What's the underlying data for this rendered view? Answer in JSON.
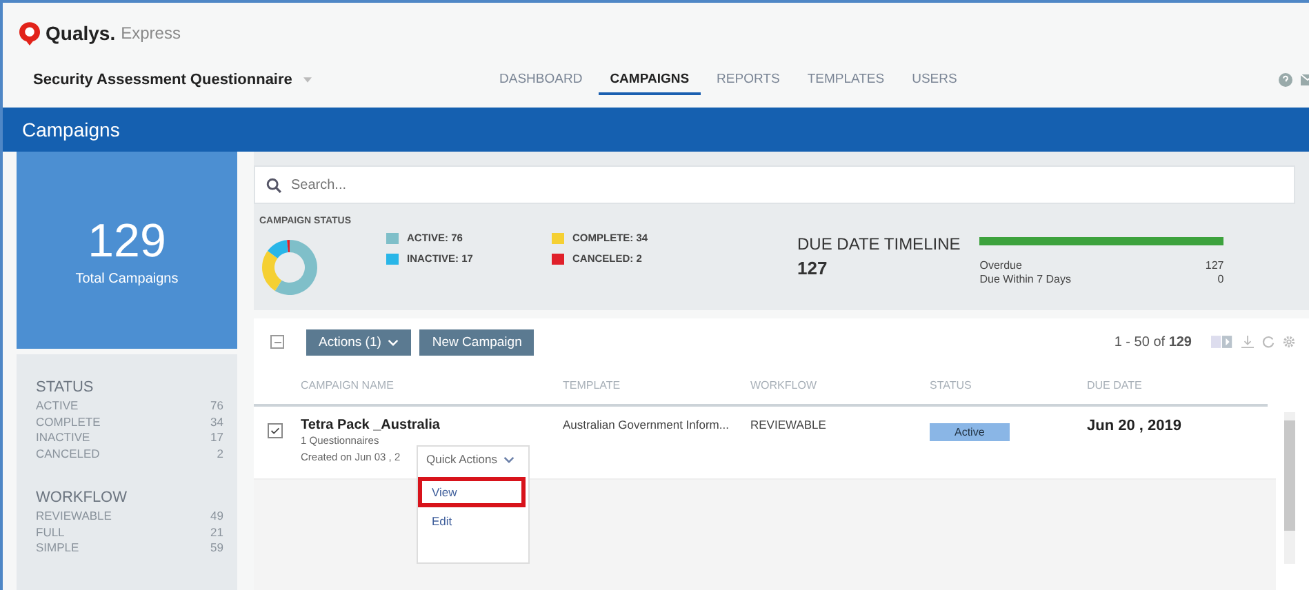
{
  "app": {
    "logo": "Qualys.",
    "product": "Express"
  },
  "workspace": "Security Assessment Questionnaire",
  "nav": [
    {
      "label": "DASHBOARD",
      "selected": false
    },
    {
      "label": "CAMPAIGNS",
      "selected": true
    },
    {
      "label": "REPORTS",
      "selected": false
    },
    {
      "label": "TEMPLATES",
      "selected": false
    },
    {
      "label": "USERS",
      "selected": false
    }
  ],
  "page_title": "Campaigns",
  "total": {
    "value": "129",
    "label": "Total Campaigns"
  },
  "sidebar": [
    {
      "title": "STATUS",
      "items": [
        {
          "label": "ACTIVE",
          "count": "76"
        },
        {
          "label": "COMPLETE",
          "count": "34"
        },
        {
          "label": "INACTIVE",
          "count": "17"
        },
        {
          "label": "CANCELED",
          "count": "2"
        }
      ]
    },
    {
      "title": "WORKFLOW",
      "items": [
        {
          "label": "REVIEWABLE",
          "count": "49"
        },
        {
          "label": "FULL",
          "count": "21"
        },
        {
          "label": "SIMPLE",
          "count": "59"
        }
      ]
    }
  ],
  "search": {
    "placeholder": "Search..."
  },
  "campaign_status": {
    "title": "CAMPAIGN STATUS",
    "legend": [
      {
        "label": "ACTIVE:",
        "value": "76",
        "color": "#7fbfc9"
      },
      {
        "label": "COMPLETE:",
        "value": "34",
        "color": "#f5d033"
      },
      {
        "label": "INACTIVE:",
        "value": "17",
        "color": "#29b6e8"
      },
      {
        "label": "CANCELED:",
        "value": "2",
        "color": "#e0202a"
      }
    ]
  },
  "due_date": {
    "title": "DUE DATE TIMELINE",
    "total": "127",
    "level": 1,
    "rows": [
      {
        "label": "Overdue",
        "value": "127"
      },
      {
        "label": "Due Within 7 Days",
        "value": "0"
      }
    ]
  },
  "toolbar": {
    "select_all_partial": true,
    "actions": "Actions (1)",
    "new": "New Campaign",
    "pagination": "1 - 50 of",
    "total": "129"
  },
  "table": {
    "columns": [
      "CAMPAIGN NAME",
      "TEMPLATE",
      "WORKFLOW",
      "STATUS",
      "DUE DATE"
    ],
    "rows": [
      {
        "checked": true,
        "name": "Tetra Pack _Australia",
        "questionnaires": "1 Questionnaires",
        "created": "Created on Jun 03 , 2",
        "template": "Australian Government Inform...",
        "workflow": "REVIEWABLE",
        "status": "Active",
        "due": "Jun 20 , 2019"
      }
    ]
  },
  "quick_actions": {
    "label": "Quick Actions",
    "items": [
      {
        "label": "View",
        "selected": true
      },
      {
        "label": "Edit",
        "selected": false
      }
    ]
  }
}
